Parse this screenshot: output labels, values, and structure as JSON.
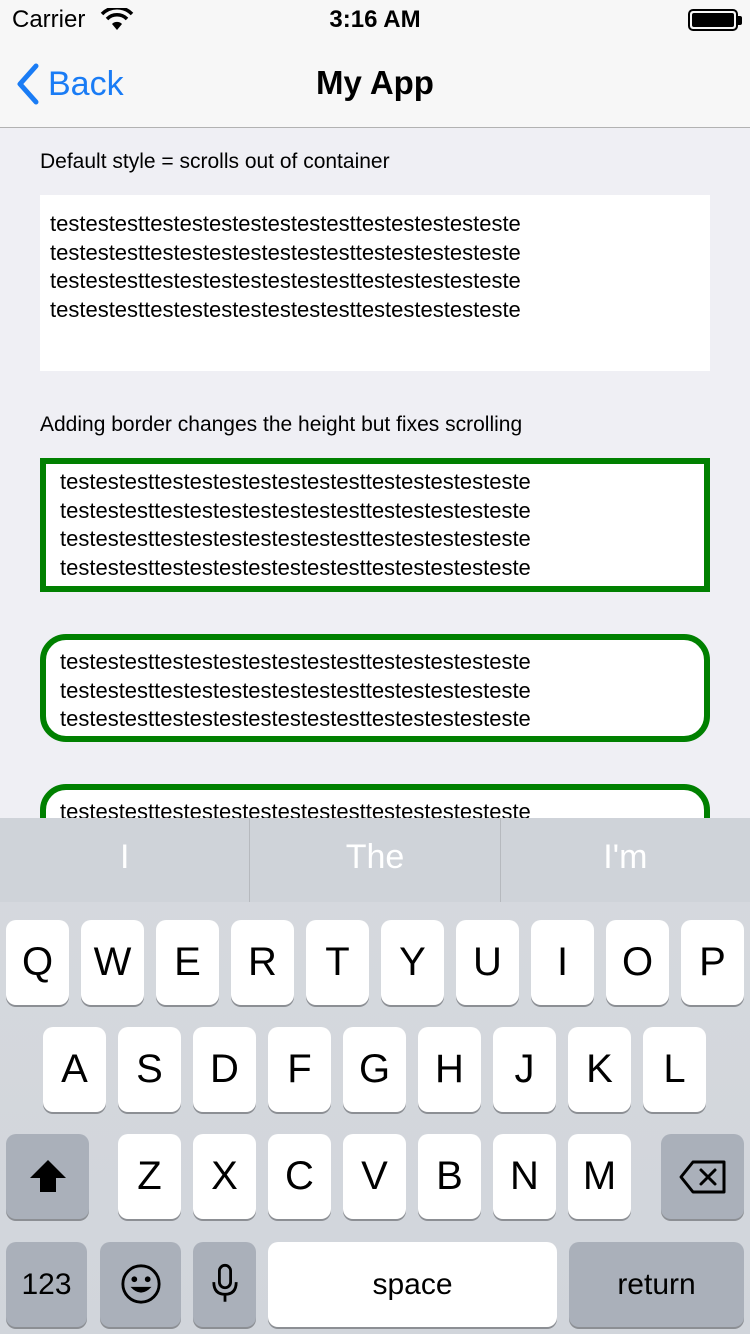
{
  "status": {
    "carrier": "Carrier",
    "time": "3:16 AM"
  },
  "nav": {
    "back_label": "Back",
    "title": "My App"
  },
  "content": {
    "label1": "Default style = scrolls out of container",
    "box1": "testestesttestestestestestestesttestestestesteste\ntestestesttestestestestestestesttestestestesteste\ntestestesttestestestestestestesttestestestesteste\ntestestesttestestestestestestesttestestestesteste",
    "label2": "Adding border changes the height but fixes scrolling",
    "box2": "testestesttestestestestestestesttestestestesteste\ntestestesttestestestestestestesttestestestesteste\ntestestesttestestestestestestesttestestestesteste\ntestestesttestestestestestestesttestestestesteste",
    "box3": "testestesttestestestestestestesttestestestesteste\ntestestesttestestestestestestesttestestestesteste\ntestestesttestestestestestestesttestestestesteste",
    "box4": "testestesttestestestestestestesttestestestesteste"
  },
  "keyboard": {
    "suggestions": [
      "I",
      "The",
      "I'm"
    ],
    "row1": [
      "Q",
      "W",
      "E",
      "R",
      "T",
      "Y",
      "U",
      "I",
      "O",
      "P"
    ],
    "row2": [
      "A",
      "S",
      "D",
      "F",
      "G",
      "H",
      "J",
      "K",
      "L"
    ],
    "row3": [
      "Z",
      "X",
      "C",
      "V",
      "B",
      "N",
      "M"
    ],
    "numbers_label": "123",
    "space_label": "space",
    "return_label": "return"
  }
}
